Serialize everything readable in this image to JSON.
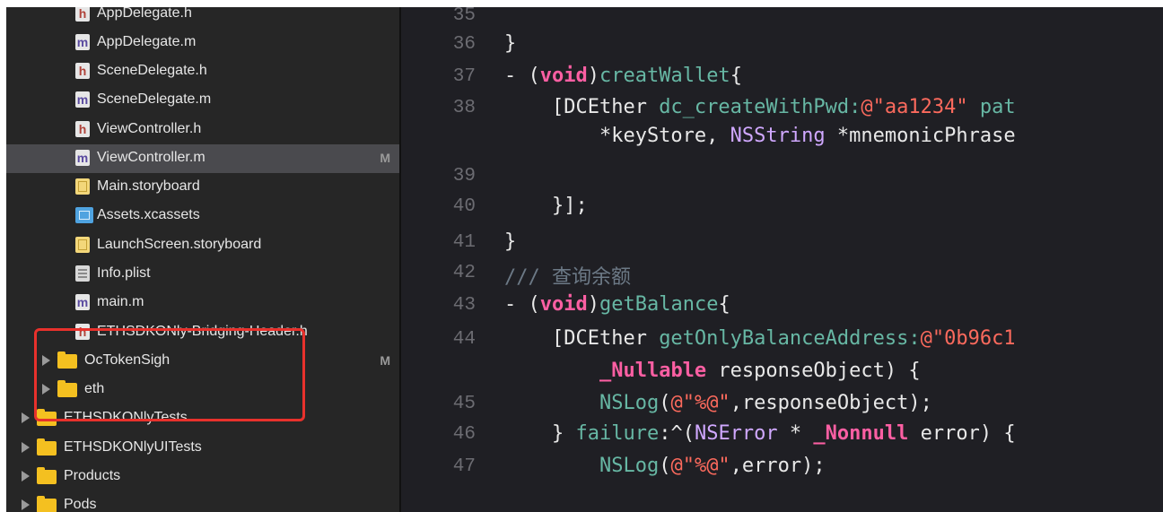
{
  "navigator": {
    "items": [
      {
        "label": "AppDelegate.h",
        "icon": "h-file-icon",
        "badge": ""
      },
      {
        "label": "AppDelegate.m",
        "icon": "m-file-icon",
        "badge": ""
      },
      {
        "label": "SceneDelegate.h",
        "icon": "h-file-icon",
        "badge": ""
      },
      {
        "label": "SceneDelegate.m",
        "icon": "m-file-icon",
        "badge": ""
      },
      {
        "label": "ViewController.h",
        "icon": "h-file-icon",
        "badge": ""
      },
      {
        "label": "ViewController.m",
        "icon": "m-file-icon",
        "badge": "M",
        "selected": true
      },
      {
        "label": "Main.storyboard",
        "icon": "storyboard-icon",
        "badge": ""
      },
      {
        "label": "Assets.xcassets",
        "icon": "xcassets-icon",
        "badge": ""
      },
      {
        "label": "LaunchScreen.storyboard",
        "icon": "storyboard-icon",
        "badge": ""
      },
      {
        "label": "Info.plist",
        "icon": "plist-icon",
        "badge": ""
      },
      {
        "label": "main.m",
        "icon": "m-file-icon",
        "badge": ""
      },
      {
        "label": "ETHSDKONly-Bridging-Header.h",
        "icon": "h-file-icon",
        "badge": ""
      },
      {
        "label": "OcTokenSigh",
        "icon": "folder-icon",
        "badge": "M"
      },
      {
        "label": "eth",
        "icon": "folder-icon",
        "badge": ""
      },
      {
        "label": "ETHSDKONlyTests",
        "icon": "folder-icon",
        "badge": ""
      },
      {
        "label": "ETHSDKONlyUITests",
        "icon": "folder-icon",
        "badge": ""
      },
      {
        "label": "Products",
        "icon": "folder-icon",
        "badge": ""
      },
      {
        "label": "Pods",
        "icon": "folder-icon",
        "badge": ""
      }
    ]
  },
  "editor": {
    "lines": [
      {
        "num": "35",
        "parts": []
      },
      {
        "num": "36",
        "parts": [
          {
            "t": "}",
            "c": ""
          }
        ]
      },
      {
        "num": "37",
        "parts": [
          {
            "t": "- (",
            "c": ""
          },
          {
            "t": "void",
            "c": "kw"
          },
          {
            "t": ")",
            "c": ""
          },
          {
            "t": "creatWallet",
            "c": "fn"
          },
          {
            "t": "{",
            "c": ""
          }
        ]
      },
      {
        "num": "38",
        "parts": [
          {
            "t": "    [DCEther ",
            "c": ""
          },
          {
            "t": "dc_createWithPwd:",
            "c": "fn"
          },
          {
            "t": "@\"aa1234\"",
            "c": "str"
          },
          {
            "t": " pat",
            "c": "fn"
          }
        ]
      },
      {
        "num": "",
        "parts": [
          {
            "t": "        *keyStore, ",
            "c": ""
          },
          {
            "t": "NSString",
            "c": "cls"
          },
          {
            "t": " *mnemonicPhrase",
            "c": ""
          }
        ]
      },
      {
        "num": "39",
        "parts": []
      },
      {
        "num": "40",
        "parts": [
          {
            "t": "    }];",
            "c": ""
          }
        ]
      },
      {
        "num": "41",
        "parts": [
          {
            "t": "}",
            "c": ""
          }
        ]
      },
      {
        "num": "42",
        "parts": [
          {
            "t": "/// 查询余额",
            "c": "cm"
          }
        ]
      },
      {
        "num": "43",
        "parts": [
          {
            "t": "- (",
            "c": ""
          },
          {
            "t": "void",
            "c": "kw"
          },
          {
            "t": ")",
            "c": ""
          },
          {
            "t": "getBalance",
            "c": "fn"
          },
          {
            "t": "{",
            "c": ""
          }
        ]
      },
      {
        "num": "44",
        "parts": [
          {
            "t": "    [DCEther ",
            "c": ""
          },
          {
            "t": "getOnlyBalanceAddress:",
            "c": "fn"
          },
          {
            "t": "@\"0b96c1",
            "c": "str"
          }
        ]
      },
      {
        "num": "",
        "parts": [
          {
            "t": "        ",
            "c": ""
          },
          {
            "t": "_Nullable",
            "c": "kw"
          },
          {
            "t": " responseObject) {",
            "c": ""
          }
        ]
      },
      {
        "num": "45",
        "parts": [
          {
            "t": "        ",
            "c": ""
          },
          {
            "t": "NSLog",
            "c": "fn"
          },
          {
            "t": "(",
            "c": ""
          },
          {
            "t": "@\"%@\"",
            "c": "str"
          },
          {
            "t": ",responseObject);",
            "c": ""
          }
        ]
      },
      {
        "num": "46",
        "parts": [
          {
            "t": "    } ",
            "c": ""
          },
          {
            "t": "failure",
            "c": "fn"
          },
          {
            "t": ":^(",
            "c": ""
          },
          {
            "t": "NSError",
            "c": "cls"
          },
          {
            "t": " * ",
            "c": ""
          },
          {
            "t": "_Nonnull",
            "c": "kw"
          },
          {
            "t": " error) {",
            "c": ""
          }
        ]
      },
      {
        "num": "47",
        "parts": [
          {
            "t": "        ",
            "c": ""
          },
          {
            "t": "NSLog",
            "c": "fn"
          },
          {
            "t": "(",
            "c": ""
          },
          {
            "t": "@\"%@\"",
            "c": "str"
          },
          {
            "t": ",error);",
            "c": ""
          }
        ]
      }
    ]
  }
}
